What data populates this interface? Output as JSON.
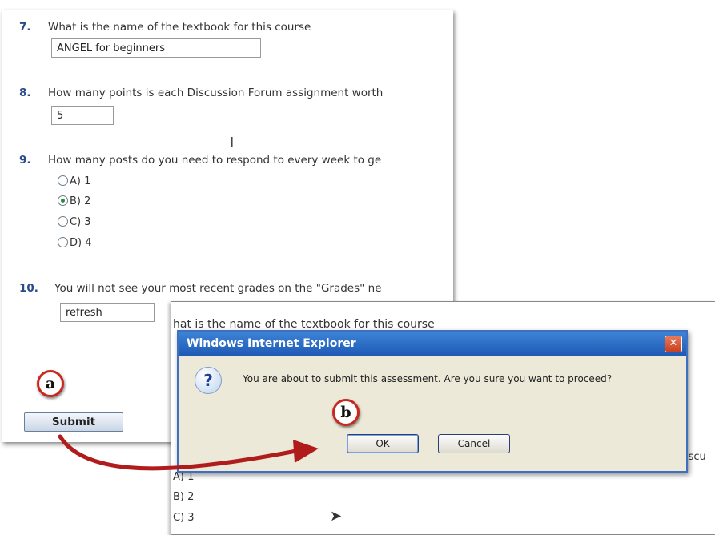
{
  "quiz": {
    "q7": {
      "number": "7.",
      "text": "What is the name of the textbook for this course",
      "answer": "ANGEL for beginners"
    },
    "q8": {
      "number": "8.",
      "text": "How many points is each Discussion Forum assignment worth",
      "answer": "5"
    },
    "q9": {
      "number": "9.",
      "text": "How many posts do you need to respond to every week to ge",
      "options": [
        "A) 1",
        "B) 2",
        "C) 3",
        "D) 4"
      ],
      "selected": "B) 2"
    },
    "q10": {
      "number": "10.",
      "text": "You will not see your most recent grades on the \"Grades\" ne",
      "answer": "refresh"
    },
    "submit_label": "Submit"
  },
  "background_page": {
    "q7_text": "hat is the name of the textbook for this course",
    "opt_a": "A) 1",
    "opt_b": "B) 2",
    "opt_c": "C) 3",
    "right_partial": "iscu"
  },
  "dialog": {
    "title": "Windows Internet Explorer",
    "close_glyph": "✕",
    "message": "You are about to submit this assessment.  Are you sure you want to proceed?",
    "ok_label": "OK",
    "cancel_label": "Cancel",
    "icon": "question-icon"
  },
  "annotations": {
    "a_label": "a",
    "b_label": "b",
    "arrow_color": "#b01c1c",
    "badge_border": "#c8281f"
  }
}
